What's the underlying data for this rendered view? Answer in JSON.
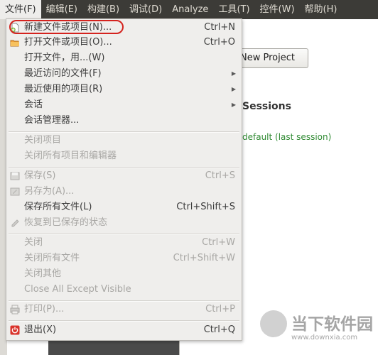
{
  "menubar": {
    "items": [
      "文件(F)",
      "编辑(E)",
      "构建(B)",
      "调试(D)",
      "Analyze",
      "工具(T)",
      "控件(W)",
      "帮助(H)"
    ]
  },
  "background": {
    "new_project_label": "New Project",
    "sessions_heading": "Sessions",
    "session_item": "default (last session)"
  },
  "file_menu": {
    "new_file_or_project": {
      "label": "新建文件或项目(N)...",
      "shortcut": "Ctrl+N"
    },
    "open_file_or_project": {
      "label": "打开文件或项目(O)...",
      "shortcut": "Ctrl+O"
    },
    "open_file_with": {
      "label": "打开文件，用...(W)"
    },
    "recent_files": {
      "label": "最近访问的文件(F)"
    },
    "recent_projects": {
      "label": "最近使用的项目(R)"
    },
    "sessions": {
      "label": "会话"
    },
    "session_manager": {
      "label": "会话管理器..."
    },
    "close_project": {
      "label": "关闭项目"
    },
    "close_all_projects_editors": {
      "label": "关闭所有项目和编辑器"
    },
    "save": {
      "label": "保存(S)",
      "shortcut": "Ctrl+S"
    },
    "save_as": {
      "label": "另存为(A)..."
    },
    "save_all": {
      "label": "保存所有文件(L)",
      "shortcut": "Ctrl+Shift+S"
    },
    "revert": {
      "label": "恢复到已保存的状态"
    },
    "close": {
      "label": "关闭",
      "shortcut": "Ctrl+W"
    },
    "close_all": {
      "label": "关闭所有文件",
      "shortcut": "Ctrl+Shift+W"
    },
    "close_others": {
      "label": "关闭其他"
    },
    "close_all_except_visible": {
      "label": "Close All Except Visible"
    },
    "print": {
      "label": "打印(P)...",
      "shortcut": "Ctrl+P"
    },
    "exit": {
      "label": "退出(X)",
      "shortcut": "Ctrl+Q"
    }
  },
  "colors": {
    "menubar_bg": "#3c3b37",
    "menu_bg": "#efeeec",
    "highlight_ring": "#d4231e",
    "disabled_text": "#a8a7a4",
    "session_green": "#2f8a32"
  },
  "watermark": {
    "text": "当下软件园",
    "url": "www.downxia.com"
  }
}
